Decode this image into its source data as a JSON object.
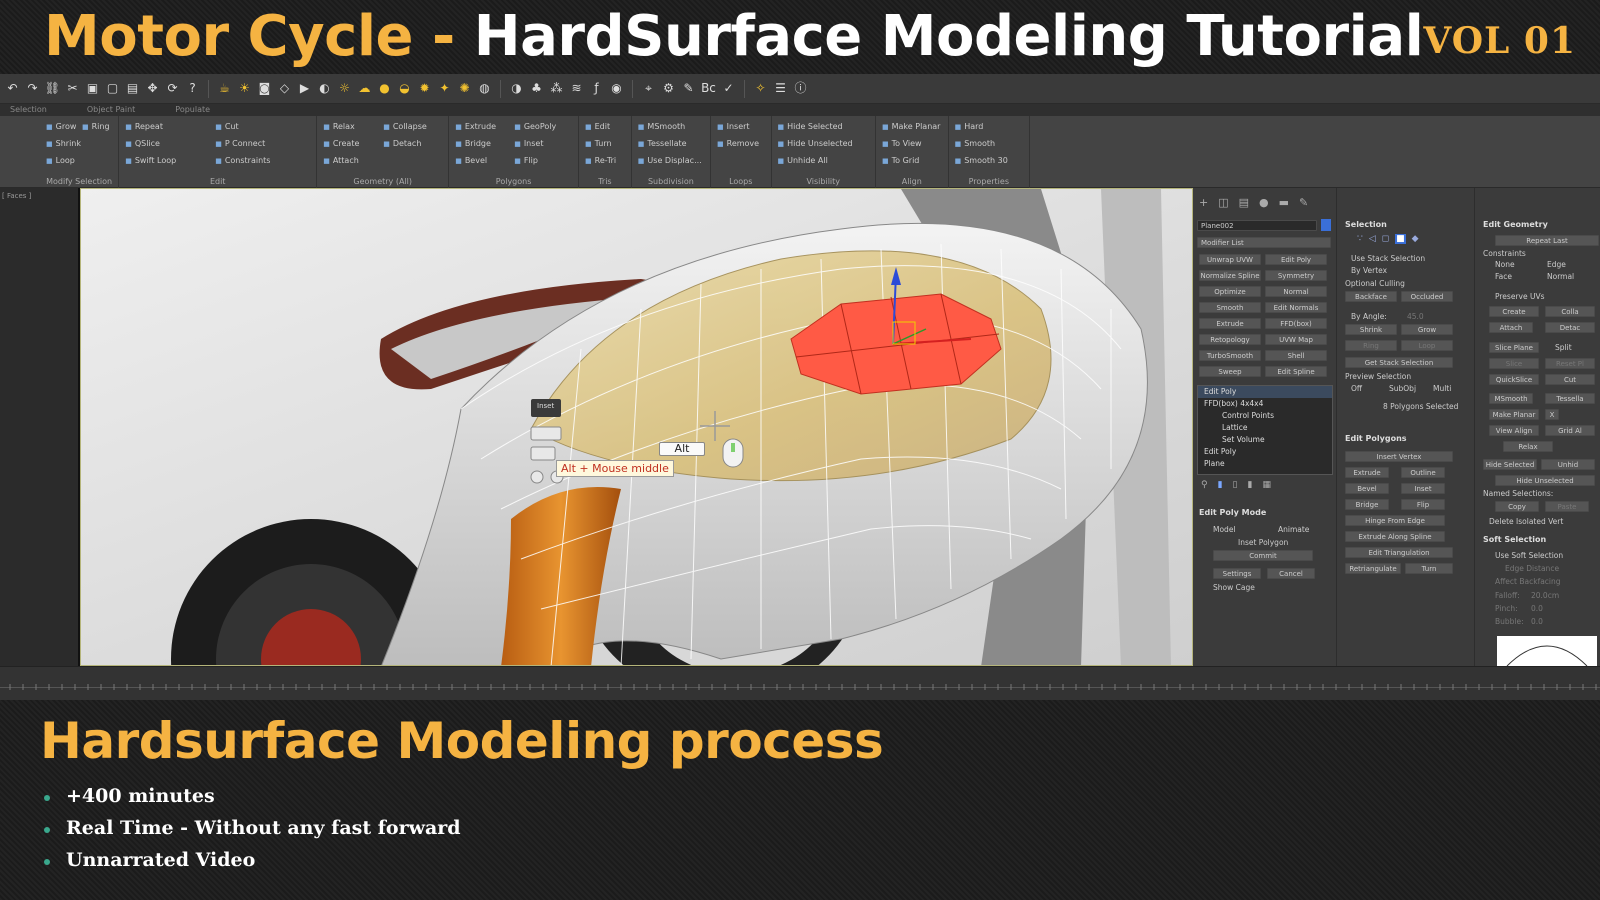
{
  "banner": {
    "title_part1": "Motor Cycle - ",
    "title_part2": "HardSurface Modeling Tutorial",
    "volume": "VOL 01"
  },
  "toolbar": {
    "icons": [
      "undo-icon",
      "redo-icon",
      "link-icon",
      "unlink-icon",
      "select-icon",
      "region-icon",
      "window-icon",
      "move-icon",
      "rotate-icon",
      "help-icon",
      "teapot-icon",
      "light-icon",
      "camera-icon",
      "helper-icon",
      "render-icon",
      "material-icon",
      "sun-icon",
      "cloud-icon",
      "sphere-icon",
      "sky-icon",
      "daylight-icon",
      "spot-icon",
      "sunburst-icon",
      "globe-icon",
      "shader-icon",
      "tree-icon",
      "particle-icon",
      "hair-icon",
      "fx-icon",
      "ball-icon",
      "snap-icon",
      "cog-icon",
      "paint-icon",
      "bc-icon",
      "check-icon",
      "bulb-icon",
      "list-icon",
      "info-icon"
    ]
  },
  "tabs": [
    "Selection",
    "Object Paint",
    "Populate"
  ],
  "ribbon": {
    "groups": [
      {
        "label": "Modify Selection",
        "items": [
          "Grow",
          "Shrink",
          "Loop",
          "Ring"
        ]
      },
      {
        "label": "Edit",
        "items": [
          "Repeat",
          "QSlice",
          "Swift Loop",
          "Cut",
          "P Connect",
          "Constraints"
        ]
      },
      {
        "label": "Geometry (All)",
        "items": [
          "Relax",
          "Create",
          "Attach",
          "Collapse",
          "Detach"
        ]
      },
      {
        "label": "Polygons",
        "items": [
          "Extrude",
          "Bridge",
          "Bevel",
          "GeoPoly",
          "Inset",
          "Flip"
        ]
      },
      {
        "label": "Tris",
        "items": [
          "Edit",
          "Turn",
          "Re-Tri"
        ]
      },
      {
        "label": "Subdivision",
        "items": [
          "MSmooth",
          "Tessellate",
          "Use Displac..."
        ]
      },
      {
        "label": "Loops",
        "items": [
          "Insert",
          "Remove"
        ]
      },
      {
        "label": "Visibility",
        "items": [
          "Hide Selected",
          "Hide Unselected",
          "Unhide All"
        ]
      },
      {
        "label": "Align",
        "items": [
          "Make Planar",
          "To View",
          "To Grid"
        ]
      },
      {
        "label": "Properties",
        "items": [
          "Hard",
          "Smooth",
          "Smooth 30"
        ]
      }
    ]
  },
  "leftpane": {
    "label": "[ Faces ]"
  },
  "viewport": {
    "alt_key": "Alt",
    "tooltip": "Alt + Mouse middle",
    "caddy_label": "Inset"
  },
  "command_panel": {
    "object_name": "Plane002",
    "modifier_list": "Modifier List",
    "modifier_buttons": [
      "Unwrap UVW",
      "Edit Poly",
      "Normalize Spline",
      "Symmetry",
      "Optimize",
      "Normal",
      "Smooth",
      "Edit Normals",
      "Extrude",
      "FFD(box)",
      "Retopology",
      "UVW Map",
      "TurboSmooth",
      "Shell",
      "Sweep",
      "Edit Spline"
    ],
    "stack": [
      "Edit Poly",
      "FFD(box) 4x4x4",
      "Control Points",
      "Lattice",
      "Set Volume",
      "Edit Poly",
      "Plane"
    ],
    "edit_poly_mode": {
      "head": "Edit Poly Mode",
      "model": "Model",
      "animate": "Animate",
      "label": "Inset Polygon",
      "commit": "Commit",
      "settings": "Settings",
      "cancel": "Cancel",
      "show_cage": "Show Cage"
    },
    "selection": {
      "head": "Selection",
      "use_stack": "Use Stack Selection",
      "by_vertex": "By Vertex",
      "ignore_culling": "Optional Culling",
      "backface": "Backface",
      "occluded": "Occluded",
      "by_angle": "By Angle:",
      "angle_value": "45.0",
      "shrink": "Shrink",
      "grow": "Grow",
      "ring": "Ring",
      "loop": "Loop",
      "get_stack": "Get Stack Selection",
      "preview": "Preview Selection",
      "off": "Off",
      "subobj": "SubObj",
      "multi": "Multi",
      "status": "8 Polygons Selected"
    },
    "edit_polygons": {
      "head": "Edit Polygons",
      "insert_vertex": "Insert Vertex",
      "extrude": "Extrude",
      "outline": "Outline",
      "bevel": "Bevel",
      "inset": "Inset",
      "bridge": "Bridge",
      "flip": "Flip",
      "hinge": "Hinge From Edge",
      "extrude_spline": "Extrude Along Spline",
      "edit_tri": "Edit Triangulation",
      "retriangulate": "Retriangulate",
      "turn": "Turn"
    },
    "edit_geometry": {
      "head": "Edit Geometry",
      "repeat_last": "Repeat Last",
      "constraints": "Constraints",
      "none": "None",
      "edge": "Edge",
      "face": "Face",
      "normal": "Normal",
      "preserve_uvs": "Preserve UVs",
      "create": "Create",
      "collapse": "Colla",
      "attach": "Attach",
      "detach": "Detac",
      "slice_plane": "Slice Plane",
      "split": "Split",
      "slice": "Slice",
      "reset_plane": "Reset Pl",
      "quickslice": "QuickSlice",
      "cut": "Cut",
      "msmooth": "MSmooth",
      "tessellate": "Tessella",
      "make_planar": "Make Planar",
      "x": "X",
      "view_align": "View Align",
      "grid_align": "Grid Al",
      "relax": "Relax",
      "hide_selected": "Hide Selected",
      "unhide": "Unhid",
      "hide_unselected": "Hide Unselected",
      "named_selections": "Named Selections:",
      "copy": "Copy",
      "paste": "Paste",
      "delete_isolated": "Delete Isolated Vert"
    },
    "soft_selection": {
      "head": "Soft Selection",
      "use_soft": "Use Soft Selection",
      "edge_distance": "Edge Distance",
      "affect_backfacing": "Affect Backfacing",
      "falloff": "Falloff:",
      "falloff_val": "20.0cm",
      "pinch": "Pinch:",
      "pinch_val": "0.0",
      "bubble": "Bubble:",
      "bubble_val": "0.0"
    }
  },
  "lower": {
    "title": "Hardsurface Modeling process",
    "bullets": [
      "+400 minutes",
      "Real Time - Without any fast forward",
      "Unnarrated Video"
    ]
  },
  "colors": {
    "accent_orange": "#f5b342",
    "bullet_green": "#3aa88d",
    "selection_red": "#ff5a45"
  }
}
